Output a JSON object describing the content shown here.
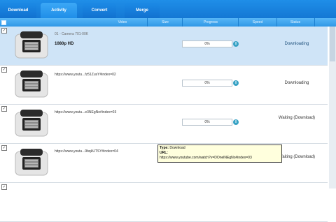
{
  "tabs": [
    {
      "label": "Download"
    },
    {
      "label": "Activity"
    },
    {
      "label": "Convert"
    },
    {
      "label": "Merge"
    }
  ],
  "columns": [
    "Video",
    "Size",
    "Progress",
    "Speed",
    "Status"
  ],
  "rows": [
    {
      "line1": "01 - Camera 701-00K",
      "line2": "1080p HD",
      "progress": "0%",
      "status": "Downloading",
      "selected": true
    },
    {
      "line1": "https://www.youtu...fz51ZusY#index=02",
      "progress": "0%",
      "status": "Downloading",
      "selected": false
    },
    {
      "line1": "https://www.youtu...e3NEgNo#index=03",
      "progress": "0%",
      "status": "Waiting (Download)",
      "selected": false
    },
    {
      "line1": "https://www.youtu...9bqkUTSY#index=04",
      "progress": "",
      "status": "Waiting (Download)",
      "selected": false
    }
  ],
  "tooltip": {
    "type_label": "Type:",
    "type_value": "Download",
    "url_label": "URL:",
    "url_value": "https://www.youtube.com/watch?v=DOnelNEgNo#index=03"
  },
  "colors": {
    "accent": "#1f8ee8",
    "selected_row": "#cfe4f7"
  }
}
